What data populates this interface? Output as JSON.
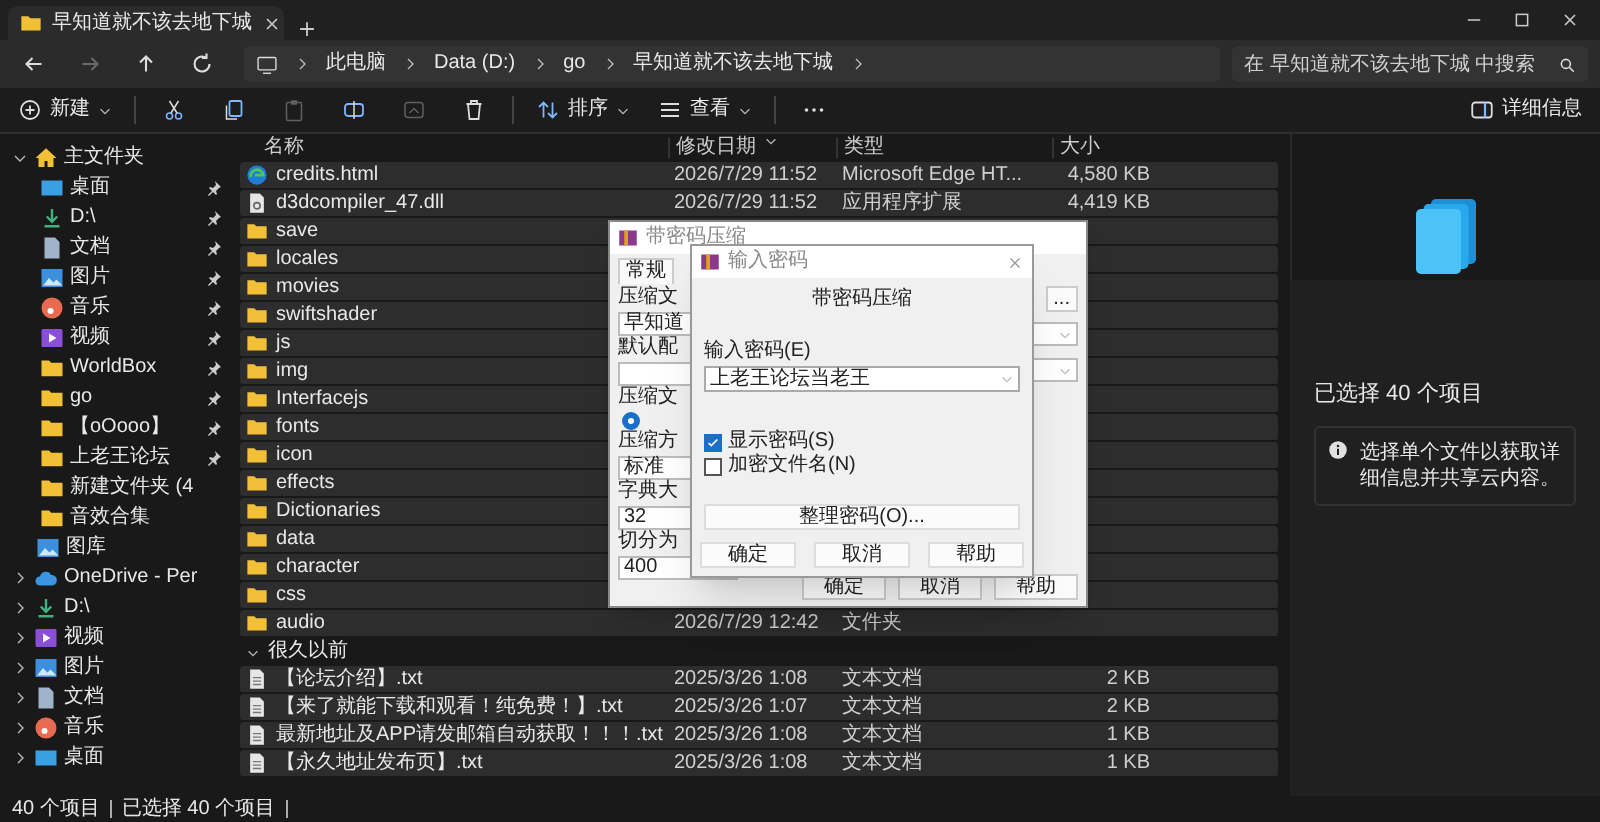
{
  "window": {
    "title": "早知道就不该去地下城"
  },
  "nav": [
    {
      "kind": "back",
      "disabled": false
    },
    {
      "kind": "forward",
      "disabled": true
    },
    {
      "kind": "up",
      "disabled": false
    },
    {
      "kind": "refresh",
      "disabled": false
    }
  ],
  "address": {
    "crumbs": [
      "此电脑",
      "Data (D:)",
      "go",
      "早知道就不该去地下城"
    ]
  },
  "search": {
    "placeholder": "在 早知道就不该去地下城 中搜索"
  },
  "toolbar": {
    "new_label": "新建",
    "actions": [
      {
        "kind": "cut",
        "disabled": false
      },
      {
        "kind": "copy",
        "disabled": false
      },
      {
        "kind": "paste",
        "disabled": true
      },
      {
        "kind": "rename",
        "disabled": false
      },
      {
        "kind": "share",
        "disabled": true
      },
      {
        "kind": "delete",
        "disabled": false
      }
    ],
    "sort_label": "排序",
    "view_label": "查看",
    "details_label": "详细信息"
  },
  "sidebar": {
    "home": {
      "label": "主文件夹",
      "expanded": true,
      "children": [
        {
          "label": "桌面",
          "kind": "desktop",
          "pinned": true
        },
        {
          "label": "D:\\",
          "kind": "download",
          "pinned": true
        },
        {
          "label": "文档",
          "kind": "docs",
          "pinned": true
        },
        {
          "label": "图片",
          "kind": "pictures",
          "pinned": true
        },
        {
          "label": "音乐",
          "kind": "music",
          "pinned": true
        },
        {
          "label": "视频",
          "kind": "videos",
          "pinned": true
        },
        {
          "label": "WorldBox",
          "kind": "folder",
          "pinned": true
        },
        {
          "label": "go",
          "kind": "folder",
          "pinned": true
        },
        {
          "label": "【oOooo】",
          "kind": "folder",
          "pinned": true
        },
        {
          "label": "上老王论坛",
          "kind": "folder",
          "pinned": true
        },
        {
          "label": "新建文件夹 (4",
          "kind": "folder",
          "pinned": false
        },
        {
          "label": "音效合集",
          "kind": "folder",
          "pinned": false
        }
      ]
    },
    "gallery": {
      "label": "图库"
    },
    "items": [
      {
        "label": "OneDrive - Per",
        "kind": "cloud",
        "expanded": false
      },
      {
        "label": "D:\\",
        "kind": "download",
        "expanded": false
      },
      {
        "label": "视频",
        "kind": "videos",
        "expanded": false
      },
      {
        "label": "图片",
        "kind": "pictures",
        "expanded": false
      },
      {
        "label": "文档",
        "kind": "docs",
        "expanded": false
      },
      {
        "label": "音乐",
        "kind": "music",
        "expanded": false
      },
      {
        "label": "桌面",
        "kind": "desktop",
        "expanded": false
      }
    ]
  },
  "table": {
    "columns": [
      "名称",
      "修改日期",
      "类型",
      "大小"
    ],
    "rows": [
      {
        "kind": "html",
        "name": "credits.html",
        "date": "2026/7/29 11:52",
        "type": "Microsoft Edge HT...",
        "size": "4,580 KB",
        "selected": true
      },
      {
        "kind": "dll",
        "name": "d3dcompiler_47.dll",
        "date": "2026/7/29 11:52",
        "type": "应用程序扩展",
        "size": "4,419 KB",
        "selected": true
      },
      {
        "kind": "folder",
        "name": "save",
        "selected": true
      },
      {
        "kind": "folder",
        "name": "locales",
        "selected": true
      },
      {
        "kind": "folder",
        "name": "movies",
        "selected": true
      },
      {
        "kind": "folder",
        "name": "swiftshader",
        "selected": true
      },
      {
        "kind": "folder",
        "name": "js",
        "selected": true
      },
      {
        "kind": "folder",
        "name": "img",
        "selected": true
      },
      {
        "kind": "folder",
        "name": "Interfacejs",
        "selected": true
      },
      {
        "kind": "folder",
        "name": "fonts",
        "selected": true
      },
      {
        "kind": "folder",
        "name": "icon",
        "selected": true
      },
      {
        "kind": "folder",
        "name": "effects",
        "selected": true
      },
      {
        "kind": "folder",
        "name": "Dictionaries",
        "selected": true
      },
      {
        "kind": "folder",
        "name": "data",
        "selected": true
      },
      {
        "kind": "folder",
        "name": "character",
        "selected": true
      },
      {
        "kind": "folder",
        "name": "css",
        "selected": true
      },
      {
        "kind": "folder",
        "name": "audio",
        "date": "2026/7/29 12:42",
        "type": "文件夹",
        "selected": true
      }
    ],
    "groups": [
      {
        "label": "很久以前",
        "expanded": true,
        "rows": [
          {
            "kind": "txt",
            "name": "【论坛介绍】.txt",
            "date": "2025/3/26 1:08",
            "type": "文本文档",
            "size": "2 KB",
            "selected": true
          },
          {
            "kind": "txt",
            "name": "【来了就能下载和观看！纯免费！】.txt",
            "date": "2025/3/26 1:07",
            "type": "文本文档",
            "size": "2 KB",
            "selected": true
          },
          {
            "kind": "txt",
            "name": "最新地址及APP请发邮箱自动获取！！！.txt",
            "date": "2025/3/26 1:08",
            "type": "文本文档",
            "size": "1 KB",
            "selected": true
          },
          {
            "kind": "txt",
            "name": "【永久地址发布页】.txt",
            "date": "2025/3/26 1:08",
            "type": "文本文档",
            "size": "1 KB",
            "selected": true
          }
        ]
      }
    ]
  },
  "details": {
    "heading": "已选择 40 个项目",
    "info": "选择单个文件以获取详细信息并共享云内容。"
  },
  "status_bar": [
    "40 个项目",
    "已选择 40 个项目"
  ],
  "archive_dialog": {
    "title": "带密码压缩",
    "tabs": [
      {
        "label": "常规",
        "selected": true
      }
    ],
    "left": [
      {
        "kind": "label",
        "text": "压缩文"
      },
      {
        "kind": "field",
        "text": "早知道"
      },
      {
        "kind": "label",
        "text": "默认配"
      },
      {
        "kind": "field"
      },
      {
        "kind": "label",
        "text": "压缩文"
      },
      {
        "kind": "radio",
        "selected": true
      },
      {
        "kind": "label",
        "text": "压缩方"
      },
      {
        "kind": "field",
        "text": "标准"
      },
      {
        "kind": "label",
        "text": "字典大"
      },
      {
        "kind": "field",
        "text": "32"
      },
      {
        "kind": "label",
        "text": "切分为"
      },
      {
        "kind": "field",
        "text": "400"
      }
    ],
    "browse_button": "...",
    "buttons": [
      "确定",
      "取消",
      "帮助"
    ]
  },
  "password_dialog": {
    "title": "输入密码",
    "heading": "带密码压缩",
    "label": "输入密码(E)",
    "value": "上老王论坛当老王",
    "options": [
      {
        "label": "显示密码(S)",
        "checked": true
      },
      {
        "label": "加密文件名(N)",
        "checked": false
      }
    ],
    "manage_button": "整理密码(O)...",
    "buttons": [
      "确定",
      "取消",
      "帮助"
    ]
  }
}
